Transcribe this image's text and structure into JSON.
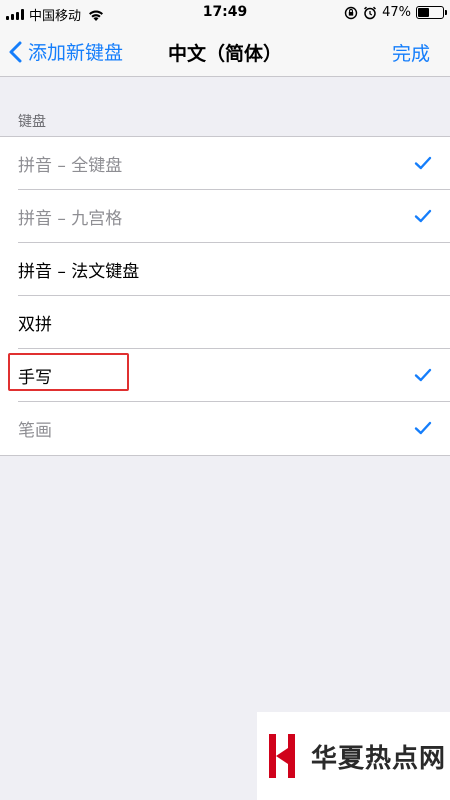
{
  "status_bar": {
    "carrier": "中国移动",
    "time": "17:49",
    "battery_text": "47%",
    "battery_level": 0.47,
    "icons": [
      "signal-icon",
      "wifi-icon",
      "orientation-lock-icon",
      "alarm-icon",
      "battery-icon"
    ]
  },
  "nav": {
    "back_label": "添加新键盘",
    "title": "中文（简体）",
    "done_label": "完成"
  },
  "section": {
    "header": "键盘",
    "rows": [
      {
        "label": "拼音 – 全键盘",
        "checked": true,
        "dimmed": true
      },
      {
        "label": "拼音 – 九宫格",
        "checked": true,
        "dimmed": true
      },
      {
        "label": "拼音 – 法文键盘",
        "checked": false,
        "dimmed": false
      },
      {
        "label": "双拼",
        "checked": false,
        "dimmed": false
      },
      {
        "label": "手写",
        "checked": true,
        "dimmed": false
      },
      {
        "label": "笔画",
        "checked": true,
        "dimmed": true
      }
    ]
  },
  "colors": {
    "accent": "#157efb",
    "highlight": "#e03030",
    "watermark_red": "#d0021b"
  },
  "watermark": {
    "text": "华夏热点网"
  }
}
